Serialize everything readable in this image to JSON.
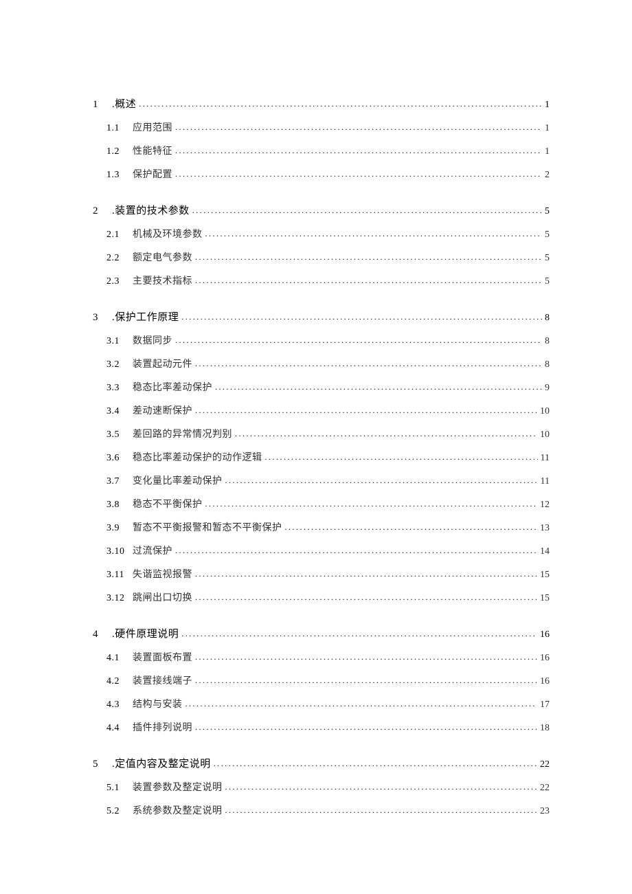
{
  "toc": [
    {
      "level": 1,
      "num": "1",
      "title": ".概述",
      "page": "1"
    },
    {
      "level": 2,
      "num": "1.1",
      "title": "应用范围",
      "page": "1"
    },
    {
      "level": 2,
      "num": "1.2",
      "title": "性能特征",
      "page": "1"
    },
    {
      "level": 2,
      "num": "1.3",
      "title": "保护配置",
      "page": "2"
    },
    {
      "level": 1,
      "num": "2",
      "title": ".装置的技术参数",
      "page": "5"
    },
    {
      "level": 2,
      "num": "2.1",
      "title": "机械及环境参数",
      "page": "5"
    },
    {
      "level": 2,
      "num": "2.2",
      "title": "额定电气参数",
      "page": "5"
    },
    {
      "level": 2,
      "num": "2.3",
      "title": "主要技术指标",
      "page": "5"
    },
    {
      "level": 1,
      "num": "3",
      "title": ".保护工作原理",
      "page": "8"
    },
    {
      "level": 2,
      "num": "3.1",
      "title": "数据同步",
      "page": "8"
    },
    {
      "level": 2,
      "num": "3.2",
      "title": "装置起动元件",
      "page": "8"
    },
    {
      "level": 2,
      "num": "3.3",
      "title": "稳态比率差动保护",
      "page": "9"
    },
    {
      "level": 2,
      "num": "3.4",
      "title": "差动速断保护",
      "page": "10"
    },
    {
      "level": 2,
      "num": "3.5",
      "title": "差回路的异常情况判别",
      "page": "10"
    },
    {
      "level": 2,
      "num": "3.6",
      "title": "稳态比率差动保护的动作逻辑",
      "page": "11"
    },
    {
      "level": 2,
      "num": "3.7",
      "title": "变化量比率差动保护",
      "page": "11"
    },
    {
      "level": 2,
      "num": "3.8",
      "title": "稳态不平衡保护",
      "page": "12"
    },
    {
      "level": 2,
      "num": "3.9",
      "title": "暂态不平衡报警和暂态不平衡保护",
      "page": "13"
    },
    {
      "level": 2,
      "num": "3.10",
      "title": "过流保护",
      "page": "14"
    },
    {
      "level": 2,
      "num": "3.11",
      "title": "失谐监视报警",
      "page": "15"
    },
    {
      "level": 2,
      "num": "3.12",
      "title": "跳闸出口切换",
      "page": "15"
    },
    {
      "level": 1,
      "num": "4",
      "title": ".硬件原理说明",
      "page": "16"
    },
    {
      "level": 2,
      "num": "4.1",
      "title": "装置面板布置",
      "page": "16"
    },
    {
      "level": 2,
      "num": "4.2",
      "title": "装置接线端子",
      "page": "16"
    },
    {
      "level": 2,
      "num": "4.3",
      "title": "结构与安装",
      "page": "17"
    },
    {
      "level": 2,
      "num": "4.4",
      "title": "插件排列说明",
      "page": "18"
    },
    {
      "level": 1,
      "num": "5",
      "title": ".定值内容及整定说明",
      "page": "22"
    },
    {
      "level": 2,
      "num": "5.1",
      "title": "装置参数及整定说明",
      "page": "22"
    },
    {
      "level": 2,
      "num": "5.2",
      "title": "系统参数及整定说明",
      "page": "23"
    }
  ]
}
